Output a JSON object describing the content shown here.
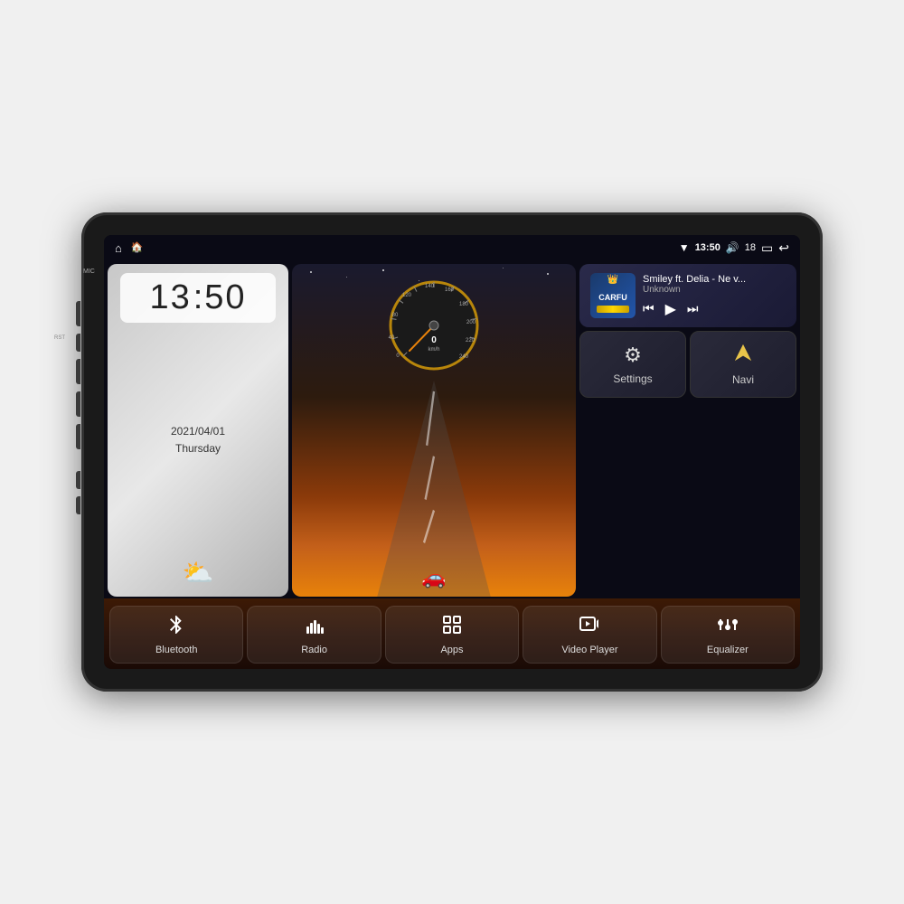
{
  "device": {
    "title": "Car Android Head Unit"
  },
  "statusBar": {
    "wifi_icon": "▼",
    "time": "13:50",
    "volume_icon": "🔊",
    "volume_level": "18",
    "battery_icon": "▭",
    "back_icon": "↩"
  },
  "clockWidget": {
    "hour": "13",
    "minute": "50",
    "date": "2021/04/01",
    "day": "Thursday",
    "weather": "⛅"
  },
  "speedometer": {
    "speed": "0",
    "unit": "km/h",
    "max_speed": "240"
  },
  "music": {
    "title": "Smiley ft. Delia - Ne v...",
    "artist": "Unknown",
    "logo": "CARFU"
  },
  "musicControls": {
    "prev": "⏮",
    "play": "▶",
    "next": "⏭"
  },
  "quickButtons": [
    {
      "id": "settings",
      "label": "Settings",
      "icon": "⚙"
    },
    {
      "id": "navi",
      "label": "Navi",
      "icon": "▲"
    }
  ],
  "dockItems": [
    {
      "id": "bluetooth",
      "label": "Bluetooth",
      "icon": "bluetooth"
    },
    {
      "id": "radio",
      "label": "Radio",
      "icon": "radio"
    },
    {
      "id": "apps",
      "label": "Apps",
      "icon": "apps"
    },
    {
      "id": "video-player",
      "label": "Video Player",
      "icon": "video"
    },
    {
      "id": "equalizer",
      "label": "Equalizer",
      "icon": "equalizer"
    }
  ],
  "sideLabels": {
    "mic": "MIC",
    "rst": "RST"
  },
  "colors": {
    "screenBg": "#0a0a15",
    "accent": "#e8820a",
    "dockBg": "#2a1208",
    "clockBg": "#d0d0d0"
  }
}
